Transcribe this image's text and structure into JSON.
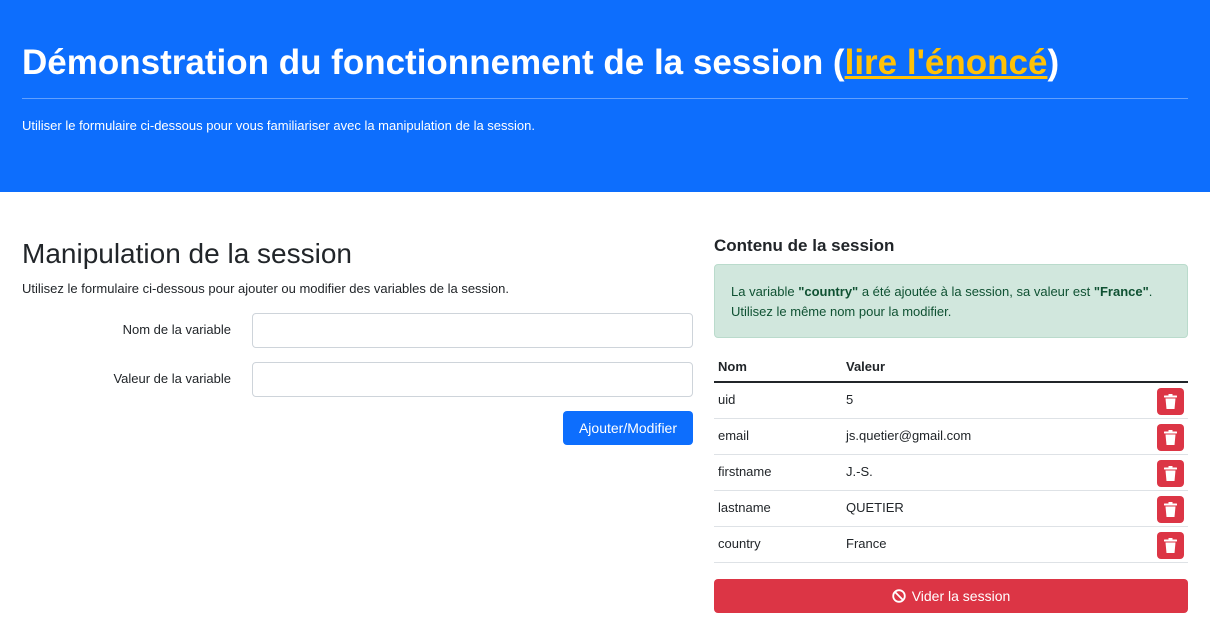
{
  "header": {
    "title_prefix": "Démonstration du fonctionnement de la session (",
    "title_link": "lire l'énoncé",
    "title_suffix": ")",
    "description": "Utiliser le formulaire ci-dessous pour vous familiariser avec la manipulation de la session."
  },
  "form": {
    "title": "Manipulation de la session",
    "description": "Utilisez le formulaire ci-dessous pour ajouter ou modifier des variables de la session.",
    "name_label": "Nom de la variable",
    "name_value": "",
    "value_label": "Valeur de la variable",
    "value_value": "",
    "submit_label": "Ajouter/Modifier"
  },
  "session": {
    "title": "Contenu de la session",
    "alert": {
      "part1": "La variable ",
      "variable": "\"country\"",
      "part2": " a été ajoutée à la session, sa valeur est ",
      "value": "\"France\"",
      "part3": ". Utilisez le même nom pour la modifier."
    },
    "columns": {
      "name": "Nom",
      "value": "Valeur"
    },
    "rows": [
      {
        "name": "uid",
        "value": "5",
        "delete_icon": "trash-icon"
      },
      {
        "name": "email",
        "value": "js.quetier@gmail.com",
        "delete_icon": "trash-icon"
      },
      {
        "name": "firstname",
        "value": "J.-S.",
        "delete_icon": "trash-icon"
      },
      {
        "name": "lastname",
        "value": "QUETIER",
        "delete_icon": "trash-icon"
      },
      {
        "name": "country",
        "value": "France",
        "delete_icon": "trash-icon"
      }
    ],
    "clear_label": "Vider la session",
    "clear_icon": "ban-icon"
  },
  "colors": {
    "primary": "#0d6efd",
    "danger": "#dc3545",
    "link": "#ffc107",
    "alert_bg": "#d1e7dd",
    "alert_text": "#0f5132"
  }
}
